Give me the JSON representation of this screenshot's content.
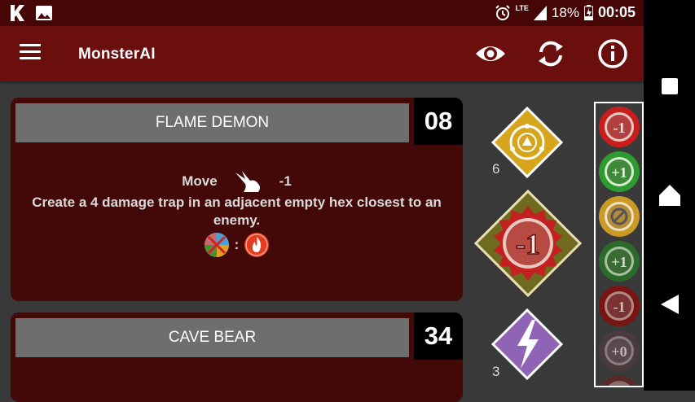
{
  "status_bar": {
    "network": "LTE",
    "battery": "18%",
    "time": "00:05"
  },
  "toolbar": {
    "title": "MonsterAI",
    "icons": [
      "menu-icon",
      "eye-icon",
      "refresh-icon",
      "info-icon"
    ]
  },
  "cards": [
    {
      "name": "FLAME DEMON",
      "initiative": "08",
      "move_label": "Move",
      "move_value": "-1",
      "ability_text": "Create a 4 damage trap in an adjacent empty hex closest to an enemy.",
      "element_separator": ":"
    },
    {
      "name": "CAVE BEAR",
      "initiative": "34"
    }
  ],
  "deck": {
    "stat_counts": [
      "6",
      "3"
    ],
    "current_modifier": "-1"
  },
  "modifier_history": [
    "-1",
    "+1",
    "null",
    "+1",
    "-1",
    "+0",
    ""
  ],
  "colors": {
    "toolbar": "#6a0e0e",
    "status_bar": "#470606",
    "card_bg": "#430808",
    "name_bar": "#6e6e6e",
    "background": "#393939"
  }
}
